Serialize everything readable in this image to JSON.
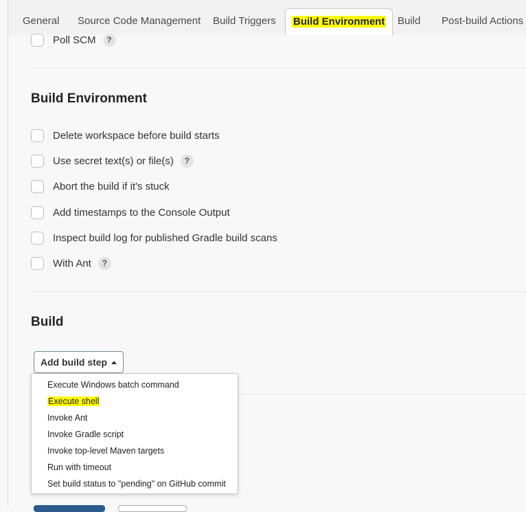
{
  "tabs": [
    {
      "label": "General"
    },
    {
      "label": "Source Code Management"
    },
    {
      "label": "Build Triggers"
    },
    {
      "label": "Build Environment",
      "active": true
    },
    {
      "label": "Build"
    },
    {
      "label": "Post-build Actions"
    }
  ],
  "build_triggers": {
    "poll_scm": {
      "label": "Poll SCM",
      "help": "?"
    }
  },
  "build_environment": {
    "title": "Build Environment",
    "options": [
      {
        "label": "Delete workspace before build starts"
      },
      {
        "label": "Use secret text(s) or file(s)",
        "help": "?"
      },
      {
        "label": "Abort the build if it's stuck"
      },
      {
        "label": "Add timestamps to the Console Output"
      },
      {
        "label": "Inspect build log for published Gradle build scans"
      },
      {
        "label": "With Ant",
        "help": "?"
      }
    ]
  },
  "build": {
    "title": "Build",
    "add_step_label": "Add build step",
    "menu": [
      {
        "label": "Execute Windows batch command"
      },
      {
        "label": "Execute shell",
        "highlighted": true
      },
      {
        "label": "Invoke Ant"
      },
      {
        "label": "Invoke Gradle script"
      },
      {
        "label": "Invoke top-level Maven targets"
      },
      {
        "label": "Run with timeout"
      },
      {
        "label": "Set build status to \"pending\" on GitHub commit"
      }
    ]
  },
  "colors": {
    "highlight": "#ffff00",
    "primary_button": "#2b5b8f"
  }
}
